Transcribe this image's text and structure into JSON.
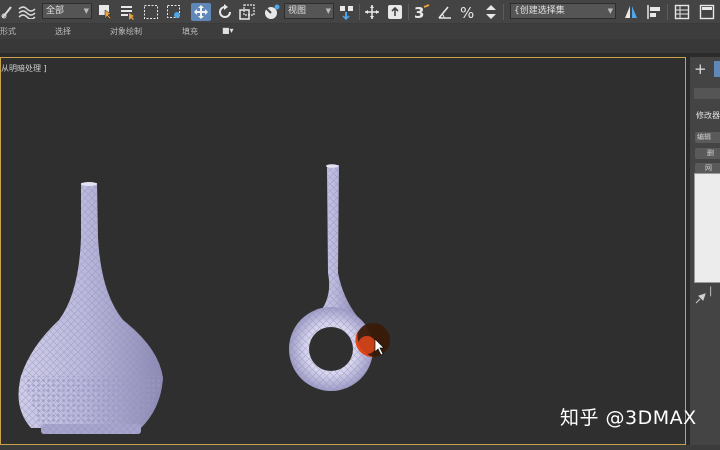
{
  "toolbar": {
    "selection_filter": "全部",
    "reference_coord": "视图",
    "named_selection_set": "{创建选择集",
    "buttons": {
      "link": "link-icon",
      "bind_space_warp": "bind-icon",
      "select": "select-icon",
      "select_by_name": "select-by-name-icon",
      "rect_region": "rect-region-icon",
      "window_crossing": "window-crossing-icon",
      "move": "move-icon",
      "rotate": "rotate-icon",
      "scale": "scale-icon",
      "placement": "placement-icon",
      "pivot": "pivot-icon",
      "manipulate": "manipulate-icon",
      "keyboard_shortcut": "keyboard-icon",
      "snap": "snap-3-icon",
      "angle_snap": "angle-snap-icon",
      "percent_snap": "percent-snap-icon",
      "spinner_snap": "spinner-snap-icon",
      "mirror": "mirror-icon",
      "align": "align-icon",
      "scene_explorer": "layers-icon",
      "table": "table-icon",
      "ribbon_toggle": "ribbon-icon"
    }
  },
  "ribbon": {
    "tabs": [
      "形式",
      "选择",
      "对象绘制",
      "填充"
    ],
    "toggle_icon": "■▾"
  },
  "viewport": {
    "label": "从明暗处理 ]",
    "border_color": "#c9a24a",
    "background": "#2f2f2f",
    "model_color": "#b9b8dc",
    "cursor_highlight_color": "#e0471a"
  },
  "command_panel": {
    "create_icon": "+",
    "modify_label": "修改器",
    "modifier_buttons": [
      "编辑",
      "删",
      "网",
      "…"
    ],
    "pin_icon": "pin-icon",
    "separator": "|"
  },
  "watermark": "知乎 @3DMAX"
}
